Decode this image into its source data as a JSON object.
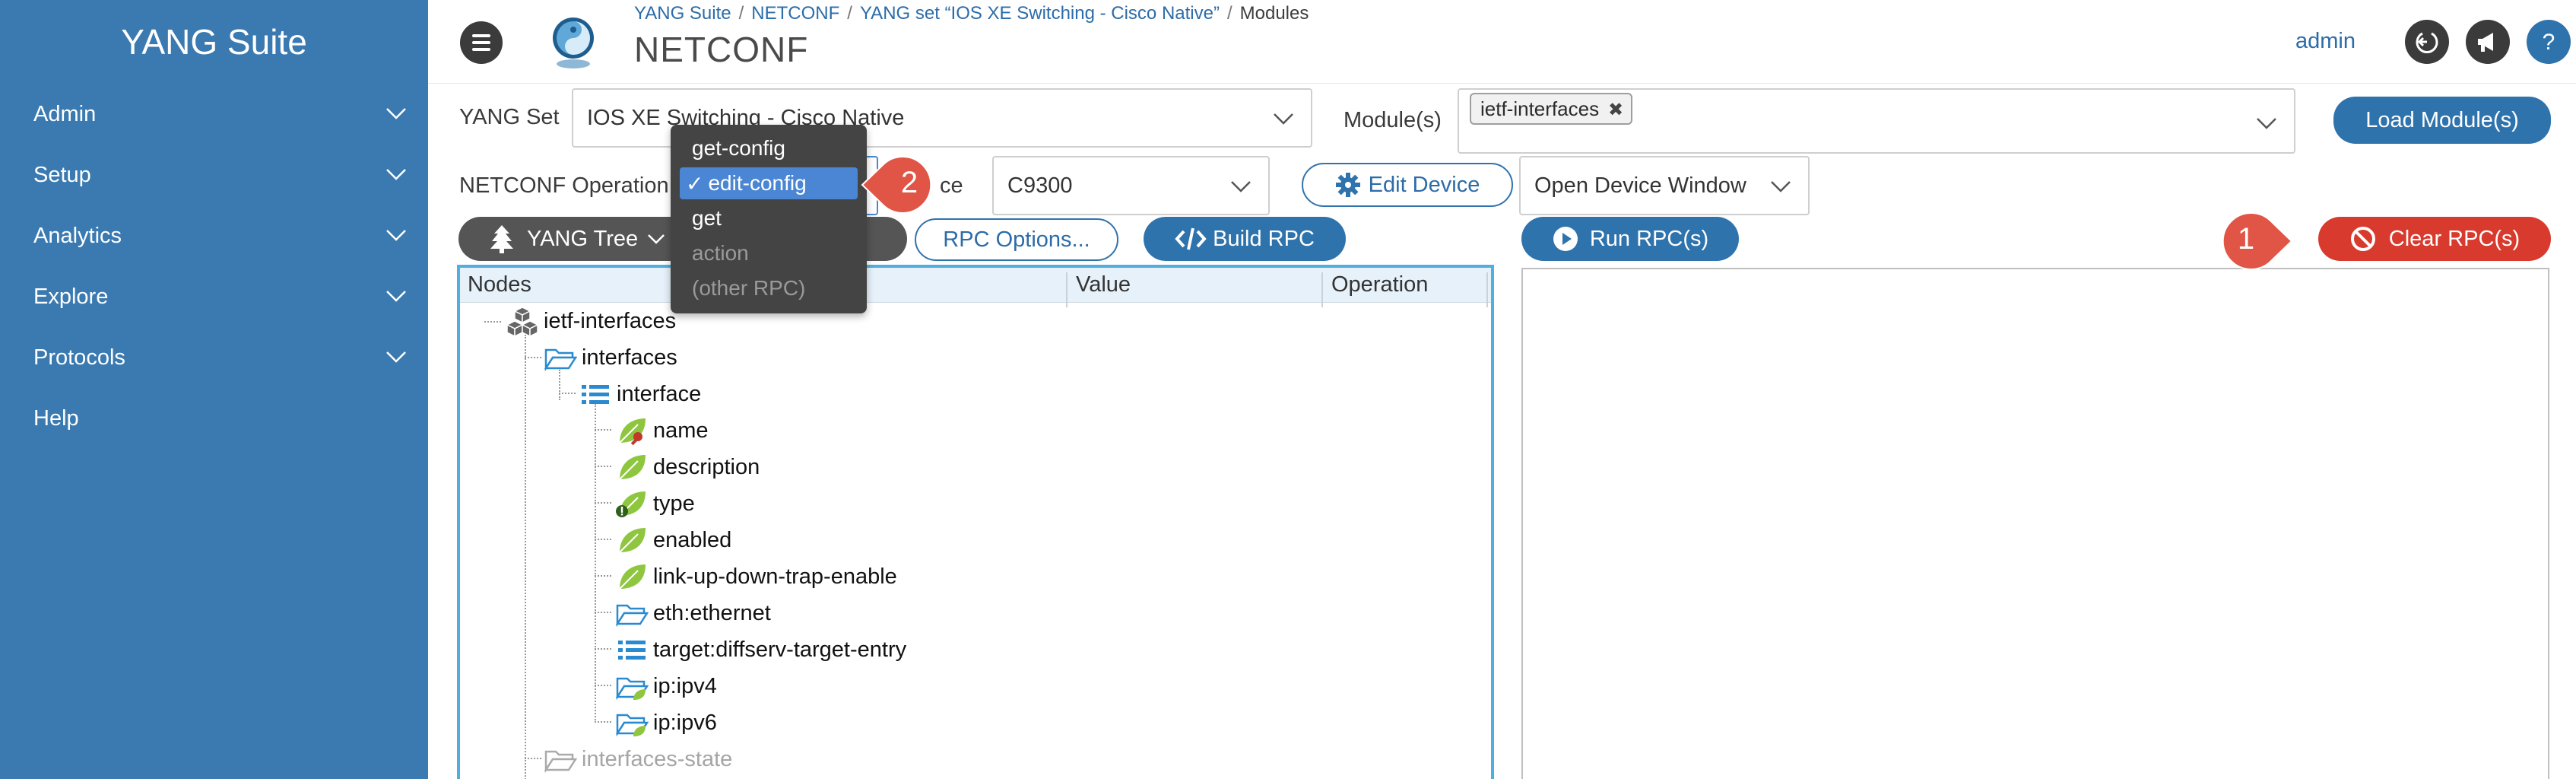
{
  "sidebar": {
    "brand": "YANG Suite",
    "items": [
      {
        "label": "Admin",
        "has_chevron": true
      },
      {
        "label": "Setup",
        "has_chevron": true
      },
      {
        "label": "Analytics",
        "has_chevron": true
      },
      {
        "label": "Explore",
        "has_chevron": true
      },
      {
        "label": "Protocols",
        "has_chevron": true
      },
      {
        "label": "Help",
        "has_chevron": false
      }
    ]
  },
  "header": {
    "breadcrumb": [
      "YANG Suite",
      "NETCONF",
      "YANG set “IOS XE Switching - Cisco Native”",
      "Modules"
    ],
    "breadcrumb_sep": "/",
    "title": "NETCONF",
    "user": "admin",
    "icons": [
      "logout-icon",
      "announcement-icon",
      "help-icon"
    ],
    "help_glyph": "?"
  },
  "form": {
    "yang_set_label": "YANG Set",
    "yang_set_value": "IOS XE Switching - Cisco Native",
    "modules_label": "Module(s)",
    "modules_selected": [
      "ietf-interfaces"
    ],
    "chip_remove": "✖",
    "load_modules_label": "Load Module(s)",
    "netconf_op_label": "NETCONF Operation",
    "device_label_fragment": "ce",
    "device_value": "C9300",
    "edit_device_label": "Edit Device",
    "open_window_value": "Open Device Window"
  },
  "toolbar": {
    "yang_tree_label": "YANG Tree",
    "rpc_options_label": "RPC Options...",
    "build_rpc_label": "Build RPC",
    "run_rpcs_label": "Run RPC(s)",
    "clear_rpcs_label": "Clear RPC(s)"
  },
  "tree": {
    "columns": [
      "Nodes",
      "Value",
      "Operation"
    ],
    "nodes": [
      {
        "label": "ietf-interfaces",
        "icon": "module-icon"
      },
      {
        "label": "interfaces",
        "icon": "folder-open-icon"
      },
      {
        "label": "interface",
        "icon": "list-icon"
      },
      {
        "label": "name",
        "icon": "leaf-key-icon"
      },
      {
        "label": "description",
        "icon": "leaf-icon"
      },
      {
        "label": "type",
        "icon": "leaf-mandatory-icon"
      },
      {
        "label": "enabled",
        "icon": "leaf-icon"
      },
      {
        "label": "link-up-down-trap-enable",
        "icon": "leaf-icon"
      },
      {
        "label": "eth:ethernet",
        "icon": "folder-icon"
      },
      {
        "label": "target:diffserv-target-entry",
        "icon": "list-icon"
      },
      {
        "label": "ip:ipv4",
        "icon": "folder-leaf-icon"
      },
      {
        "label": "ip:ipv6",
        "icon": "folder-leaf-icon"
      },
      {
        "label": "interfaces-state",
        "icon": "folder-icon"
      }
    ]
  },
  "operation_menu": {
    "check": "✓",
    "items": [
      {
        "label": "get-config",
        "selected": false,
        "disabled": false
      },
      {
        "label": "edit-config",
        "selected": true,
        "disabled": false
      },
      {
        "label": "get",
        "selected": false,
        "disabled": false
      },
      {
        "label": "action",
        "selected": false,
        "disabled": true
      },
      {
        "label": "(other RPC)",
        "selected": false,
        "disabled": true
      }
    ]
  },
  "callouts": [
    "1",
    "2"
  ],
  "colors": {
    "sidebar": "#3a7ab0",
    "primary": "#2f73ad",
    "danger": "#d83a2e",
    "callout": "#e05545",
    "tree_border": "#53aee0",
    "menu_selected": "#4a86d3"
  }
}
